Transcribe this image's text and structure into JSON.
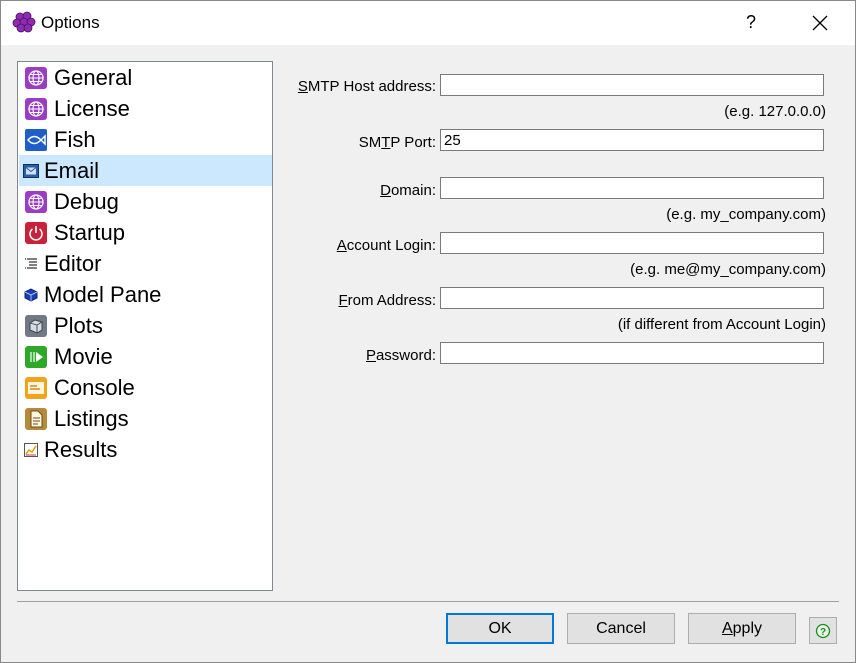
{
  "window": {
    "title": "Options",
    "help_glyph": "?",
    "close_glyph": "✕"
  },
  "nav": {
    "items": [
      {
        "label": "General",
        "icon": "globe-icon"
      },
      {
        "label": "License",
        "icon": "globe-icon"
      },
      {
        "label": "Fish",
        "icon": "fish-icon"
      },
      {
        "label": "Email",
        "icon": "envelope-icon",
        "selected": true
      },
      {
        "label": "Debug",
        "icon": "globe-icon"
      },
      {
        "label": "Startup",
        "icon": "power-icon"
      },
      {
        "label": "Editor",
        "icon": "text-lines-icon"
      },
      {
        "label": "Model Pane",
        "icon": "cube-icon"
      },
      {
        "label": "Plots",
        "icon": "box-icon"
      },
      {
        "label": "Movie",
        "icon": "play-icon"
      },
      {
        "label": "Console",
        "icon": "console-icon"
      },
      {
        "label": "Listings",
        "icon": "document-icon"
      },
      {
        "label": "Results",
        "icon": "chart-icon"
      }
    ]
  },
  "form": {
    "smtp_host": {
      "label_key": "S",
      "label_rest": "MTP Host address:",
      "value": "",
      "hint": "(e.g. 127.0.0.0)"
    },
    "smtp_port": {
      "label_pre": "SM",
      "label_key": "T",
      "label_rest": "P Port:",
      "value": "25"
    },
    "domain": {
      "label_key": "D",
      "label_rest": "omain:",
      "value": "",
      "hint": "(e.g. my_company.com)"
    },
    "account_login": {
      "label_key": "A",
      "label_rest": "ccount Login:",
      "value": "",
      "hint": "(e.g. me@my_company.com)"
    },
    "from_address": {
      "label_key": "F",
      "label_rest": "rom Address:",
      "value": "",
      "hint": "(if different from Account Login)"
    },
    "password": {
      "label_key": "P",
      "label_rest": "assword:",
      "value": ""
    }
  },
  "buttons": {
    "ok": "OK",
    "cancel": "Cancel",
    "apply_key": "A",
    "apply_rest": "pply",
    "help_glyph": "?"
  },
  "colors": {
    "selection": "#cce8ff",
    "accent": "#0078d7"
  }
}
